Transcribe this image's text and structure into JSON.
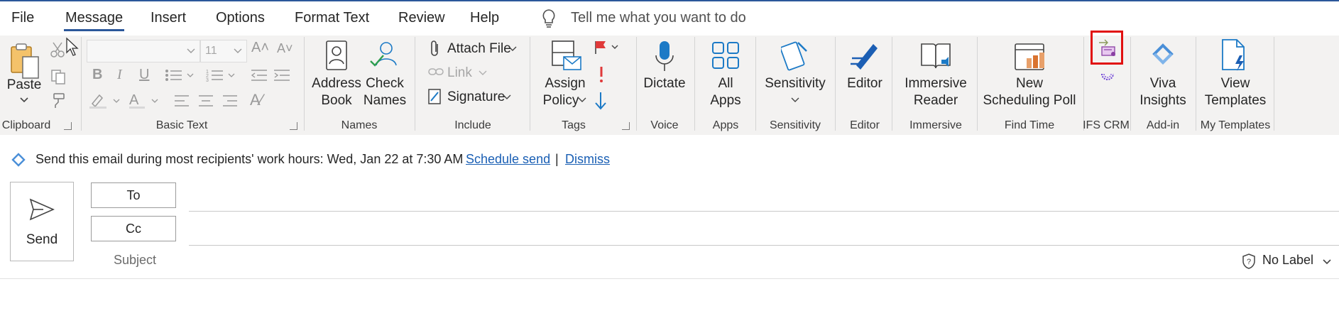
{
  "menu": {
    "tabs": [
      {
        "label": "File"
      },
      {
        "label": "Message"
      },
      {
        "label": "Insert"
      },
      {
        "label": "Options"
      },
      {
        "label": "Format Text"
      },
      {
        "label": "Review"
      },
      {
        "label": "Help"
      }
    ],
    "active_tab": "Message",
    "tell_me": "Tell me what you want to do"
  },
  "ribbon": {
    "clipboard": {
      "paste": "Paste",
      "group": "Clipboard"
    },
    "basic_text": {
      "font_name": "",
      "font_size": "11",
      "group": "Basic Text"
    },
    "names": {
      "address": "Address",
      "book": "Book",
      "check": "Check",
      "names": "Names",
      "group": "Names"
    },
    "include": {
      "attach_file": "Attach File",
      "link": "Link",
      "signature": "Signature",
      "group": "Include"
    },
    "tags": {
      "assign": "Assign",
      "policy": "Policy",
      "group": "Tags"
    },
    "voice": {
      "dictate": "Dictate",
      "group": "Voice"
    },
    "apps": {
      "all": "All",
      "apps": "Apps",
      "group": "Apps"
    },
    "sensitivity": {
      "label": "Sensitivity",
      "group": "Sensitivity"
    },
    "editor": {
      "label": "Editor",
      "group": "Editor"
    },
    "immersive": {
      "immersive": "Immersive",
      "reader": "Reader",
      "group": "Immersive"
    },
    "find_time": {
      "new": "New",
      "poll": "Scheduling Poll",
      "group": "Find Time"
    },
    "ifs_crm": {
      "group": "IFS CRM"
    },
    "addin": {
      "viva": "Viva",
      "insights": "Insights",
      "group": "Add-in"
    },
    "templates": {
      "view": "View",
      "templates": "Templates",
      "group": "My Templates"
    }
  },
  "infobar": {
    "message": "Send this email during most recipients' work hours: Wed, Jan 22 at 7:30 AM",
    "schedule_send": "Schedule send",
    "separator": "|",
    "dismiss": "Dismiss"
  },
  "compose": {
    "send": "Send",
    "to": "To",
    "cc": "Cc",
    "subject": "Subject",
    "sensitivity_label": "No Label"
  },
  "colors": {
    "accent": "#2b579a",
    "ribbon_bg": "#f3f2f1",
    "highlight": "#e11010",
    "link": "#1a5fb4"
  }
}
